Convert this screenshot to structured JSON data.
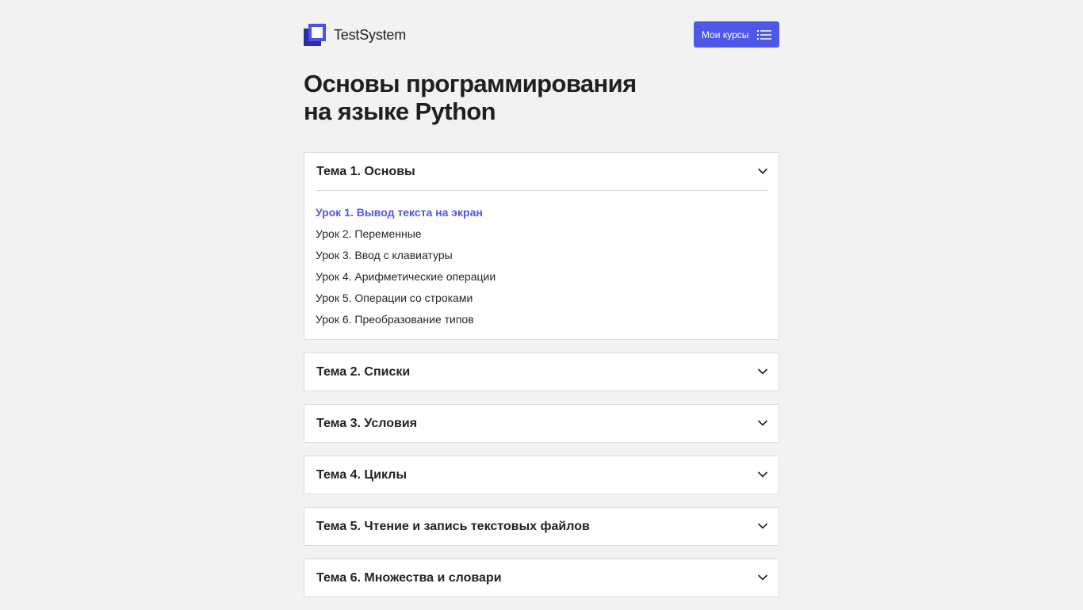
{
  "header": {
    "logo_text": "TestSystem",
    "courses_button": "Мои курсы"
  },
  "course": {
    "title_line1": "Основы программирования",
    "title_line2": "на языке Python"
  },
  "topics": [
    {
      "title": "Тема 1. Основы",
      "expanded": true,
      "lessons": [
        "Урок 1. Вывод текста на экран",
        "Урок 2. Переменные",
        "Урок 3. Ввод с клавиатуры",
        "Урок 4. Арифметические операции",
        "Урок 5. Операции со строками",
        "Урок 6. Преобразование типов"
      ],
      "active_lesson": 0
    },
    {
      "title": "Тема 2. Списки",
      "expanded": false
    },
    {
      "title": "Тема 3. Условия",
      "expanded": false
    },
    {
      "title": "Тема 4. Циклы",
      "expanded": false
    },
    {
      "title": "Тема 5. Чтение и запись текстовых файлов",
      "expanded": false
    },
    {
      "title": "Тема 6. Множества и словари",
      "expanded": false
    }
  ],
  "icons": {
    "logo": "logo-icon",
    "courses_button": "list-icon",
    "topic_toggle": "chevron-down-icon"
  },
  "colors": {
    "accent": "#4f57e9",
    "logo_dark": "#2b2f9e",
    "background": "#f2f2f2"
  }
}
